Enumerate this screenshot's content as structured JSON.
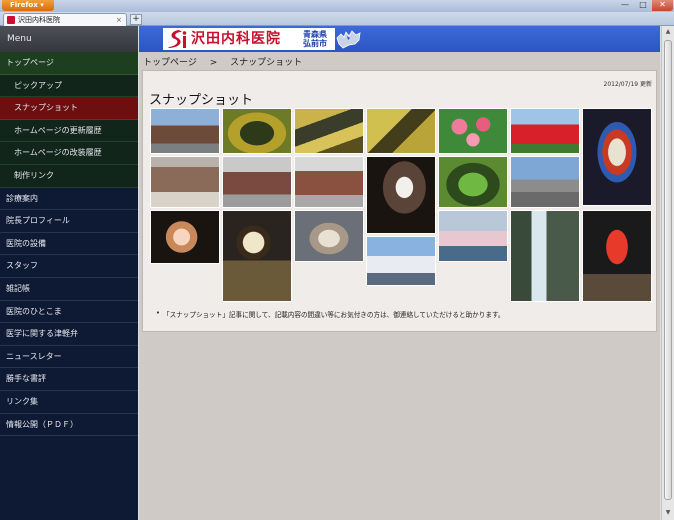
{
  "browser": {
    "app_label": "Firefox",
    "tab_title": "沢田内科医院",
    "tab_close": "×",
    "new_tab": "+",
    "min": "—",
    "max": "□",
    "close": "✕"
  },
  "menu_header": "Menu",
  "nav": [
    {
      "label": "トップページ"
    },
    {
      "label": "ピックアップ"
    },
    {
      "label": "スナップショット"
    },
    {
      "label": "ホームページの更新履歴"
    },
    {
      "label": "ホームページの改装履歴"
    },
    {
      "label": "制作リンク"
    },
    {
      "label": "診療案内"
    },
    {
      "label": "院長プロフィール"
    },
    {
      "label": "医院の設備"
    },
    {
      "label": "スタッフ"
    },
    {
      "label": "雑記帳"
    },
    {
      "label": "医院のひとこま"
    },
    {
      "label": "医学に関する津軽弁"
    },
    {
      "label": "ニュースレター"
    },
    {
      "label": "勝手な書評"
    },
    {
      "label": "リンク集"
    },
    {
      "label": "情報公開（ＰＤＦ）"
    }
  ],
  "banner": {
    "logo_text": "沢田内科医院",
    "region_line1": "青森県",
    "region_line2": "弘前市"
  },
  "breadcrumb": {
    "home": "トップページ",
    "separator": ">",
    "current": "スナップショット"
  },
  "updated": "2012/07/19 更新",
  "page_title": "スナップショット",
  "note": "「スナップショット」記事に関して、記載内容の間違い等にお気付きの方は、御連絡していただけると助かります。",
  "colors": {
    "sidebar_bg": "#0e1a33",
    "active_item": "#6e0f0f",
    "top_item": "#1d3f1f",
    "banner": "#2b55c4",
    "logo_red": "#c8102e"
  }
}
